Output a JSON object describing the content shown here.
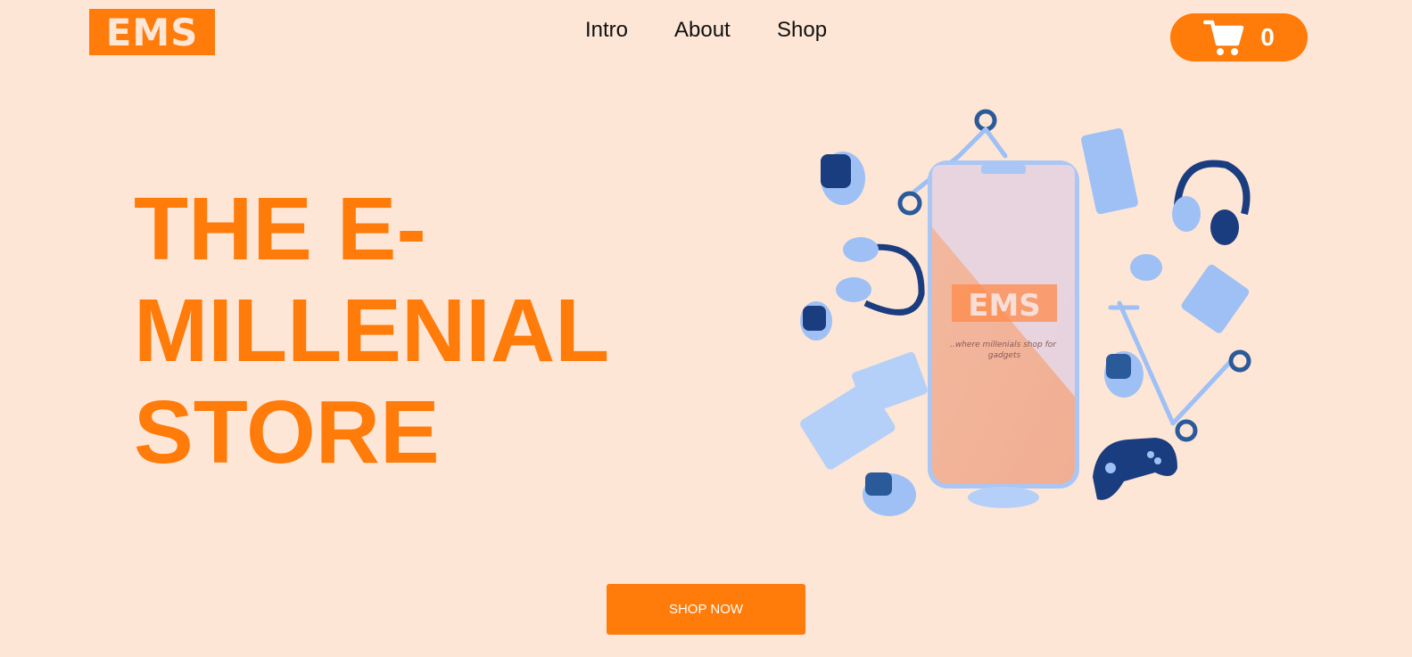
{
  "brand": {
    "logo_text": "EMS",
    "accent_color": "#ff7b0a",
    "background_color": "#fee6d6"
  },
  "nav": {
    "items": [
      "Intro",
      "About",
      "Shop"
    ]
  },
  "cart": {
    "icon": "cart-icon",
    "count": "0"
  },
  "hero": {
    "headline_lines": [
      "THE E-",
      "MILLENIAL",
      "STORE"
    ],
    "phone_logo": "EMS",
    "phone_tagline": "..where millenials shop for gadgets",
    "cta_label": "SHOP NOW"
  }
}
